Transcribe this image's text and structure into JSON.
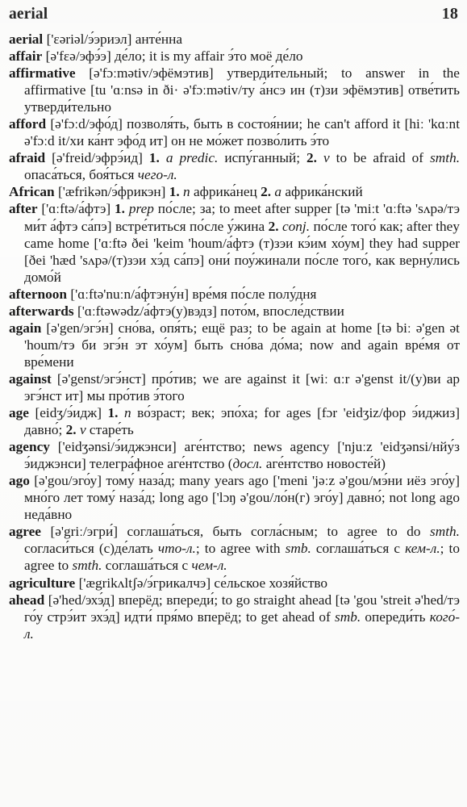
{
  "running_head": {
    "word": "aerial",
    "page_number": "18"
  },
  "entries": [
    {
      "headword": "aerial",
      "transcription": "['ɛəriəl/э́эриэл]",
      "body": " анте́нна"
    },
    {
      "headword": "affair",
      "transcription": "[ə'fɛə/эфэ́э]",
      "body": " де́ло; it is my affair э́то моё де́ло"
    },
    {
      "headword": "affirmative",
      "transcription": "[ə'fɔːmətiv/эфёмэтив]",
      "body": " утверди́тельный; to answer in the affirmative [tu 'ɑːnsə in ði· ə'fɔːmətiv/ту а́нсэ ин (т)зи эфёмэтив] отве́тить утверди́тельно"
    },
    {
      "headword": "afford",
      "transcription": "[ə'fɔːd/эфо́д]",
      "body": " позволя́ть, быть в состоя́нии; he can't afford it [hiː 'kɑːnt ə'fɔːd it/хи ка́нт эфо́д ит] он не мо́жет позво́лить э́то"
    },
    {
      "headword": "afraid",
      "transcription": "[ə'freid/эфрэ́ид]",
      "body": " 1. a predic. испу́ганный; 2. v to be afraid of smth. опаса́ться, боя́ться чего-л."
    },
    {
      "headword": "African",
      "transcription": "['æfrikən/э́фрикэн]",
      "body": " 1. n африка́нец 2. a африка́нский"
    },
    {
      "headword": "after",
      "transcription": "['ɑːftə/а́фтэ]",
      "body": " 1. prep по́сле; за; to meet after supper [tə 'miːt 'ɑːftə 'sʌpə/тэ ми́т а́фтэ са́пэ] встре́титься по́сле у́жина 2. conj. по́сле того́ как; after they came home ['ɑːftə ðei 'keim 'houm/а́фтэ (т)зэи кэ́им хо́ум] they had supper [ðei 'hæd 'sʌpə/(т)зэи хэ́д са́пэ] они́ поу́жинали по́сле того́, как верну́лись домо́й"
    },
    {
      "headword": "afternoon",
      "transcription": "['ɑːftə'nuːn/а́фтэну́н]",
      "body": " вре́мя по́сле полу́дня"
    },
    {
      "headword": "afterwards",
      "transcription": "['ɑːftəwədz/а́фтэ(у)вэдз]",
      "body": " пото́м, впосле́дствии"
    },
    {
      "headword": "again",
      "transcription": "[ə'gen/эгэ́н]",
      "body": " сно́ва, опя́ть; ещё раз; to be again at home [tə biː ə'gen ət 'houm/тэ би эгэ́н эт хо́ум] быть сно́ва до́ма; now and again вре́мя от вре́мени"
    },
    {
      "headword": "against",
      "transcription": "[ə'genst/эгэ́нст]",
      "body": " про́тив; we are against it [wiː ɑːr ə'genst it/(у)ви ар эгэ́нст ит] мы про́тив э́того"
    },
    {
      "headword": "age",
      "transcription": "[eidʒ/э́идж]",
      "body": " 1. n во́зраст; век; эпо́ха; for ages [fɔr 'eidʒiz/фор э́иджиз] давно́; 2. v старе́ть"
    },
    {
      "headword": "agency",
      "transcription": "['eidʒənsi/э́иджэнси]",
      "body": " аге́нтство; news agency ['njuːz 'eidʒənsi/нйу́з э́иджэнси] телегра́фное аге́нтство (досл. аге́нтство новосте́й)"
    },
    {
      "headword": "ago",
      "transcription": "[ə'gou/эго́у]",
      "body": " тому́ наза́д; many years ago ['meni 'jəːz ə'gou/мэ́ни иёз эго́у] мно́го лет тому́ наза́д; long ago ['lɔŋ ə'gou/ло́н(г) эго́у] давно́; not long ago неда́вно"
    },
    {
      "headword": "agree",
      "transcription": "[ə'griː/эгри́]",
      "body": " соглаша́ться, быть согла́сным; to agree to do smth. согласи́ться (с)де́лать что-л.; to agree with smb. соглаша́ться с кем-л.; to agree to smth. соглаша́ться с чем-л."
    },
    {
      "headword": "agriculture",
      "transcription": "['ægrikʌltʃə/э́грикалчэ]",
      "body": " се́льское хозя́йство"
    },
    {
      "headword": "ahead",
      "transcription": "[ə'hed/эхэ́д]",
      "body": " вперёд; впереди́; to go straight ahead [tə 'gou 'streit ə'hed/тэ го́у стрэ́ит эхэ́д] идти́ пря́мо вперёд; to get ahead of smb. опереди́ть кого́-л."
    }
  ],
  "italic_tokens": [
    "a",
    "n",
    "v",
    "prep",
    "conj.",
    "predic.",
    "smth.",
    "smb.",
    "чего-л.",
    "что-л.",
    "кем-л.",
    "чем-л.",
    "кого́-л.",
    "досл."
  ],
  "colors": {
    "paper": "#fdfdfc",
    "ink": "#1b1b1b",
    "head_ink": "#262626"
  }
}
